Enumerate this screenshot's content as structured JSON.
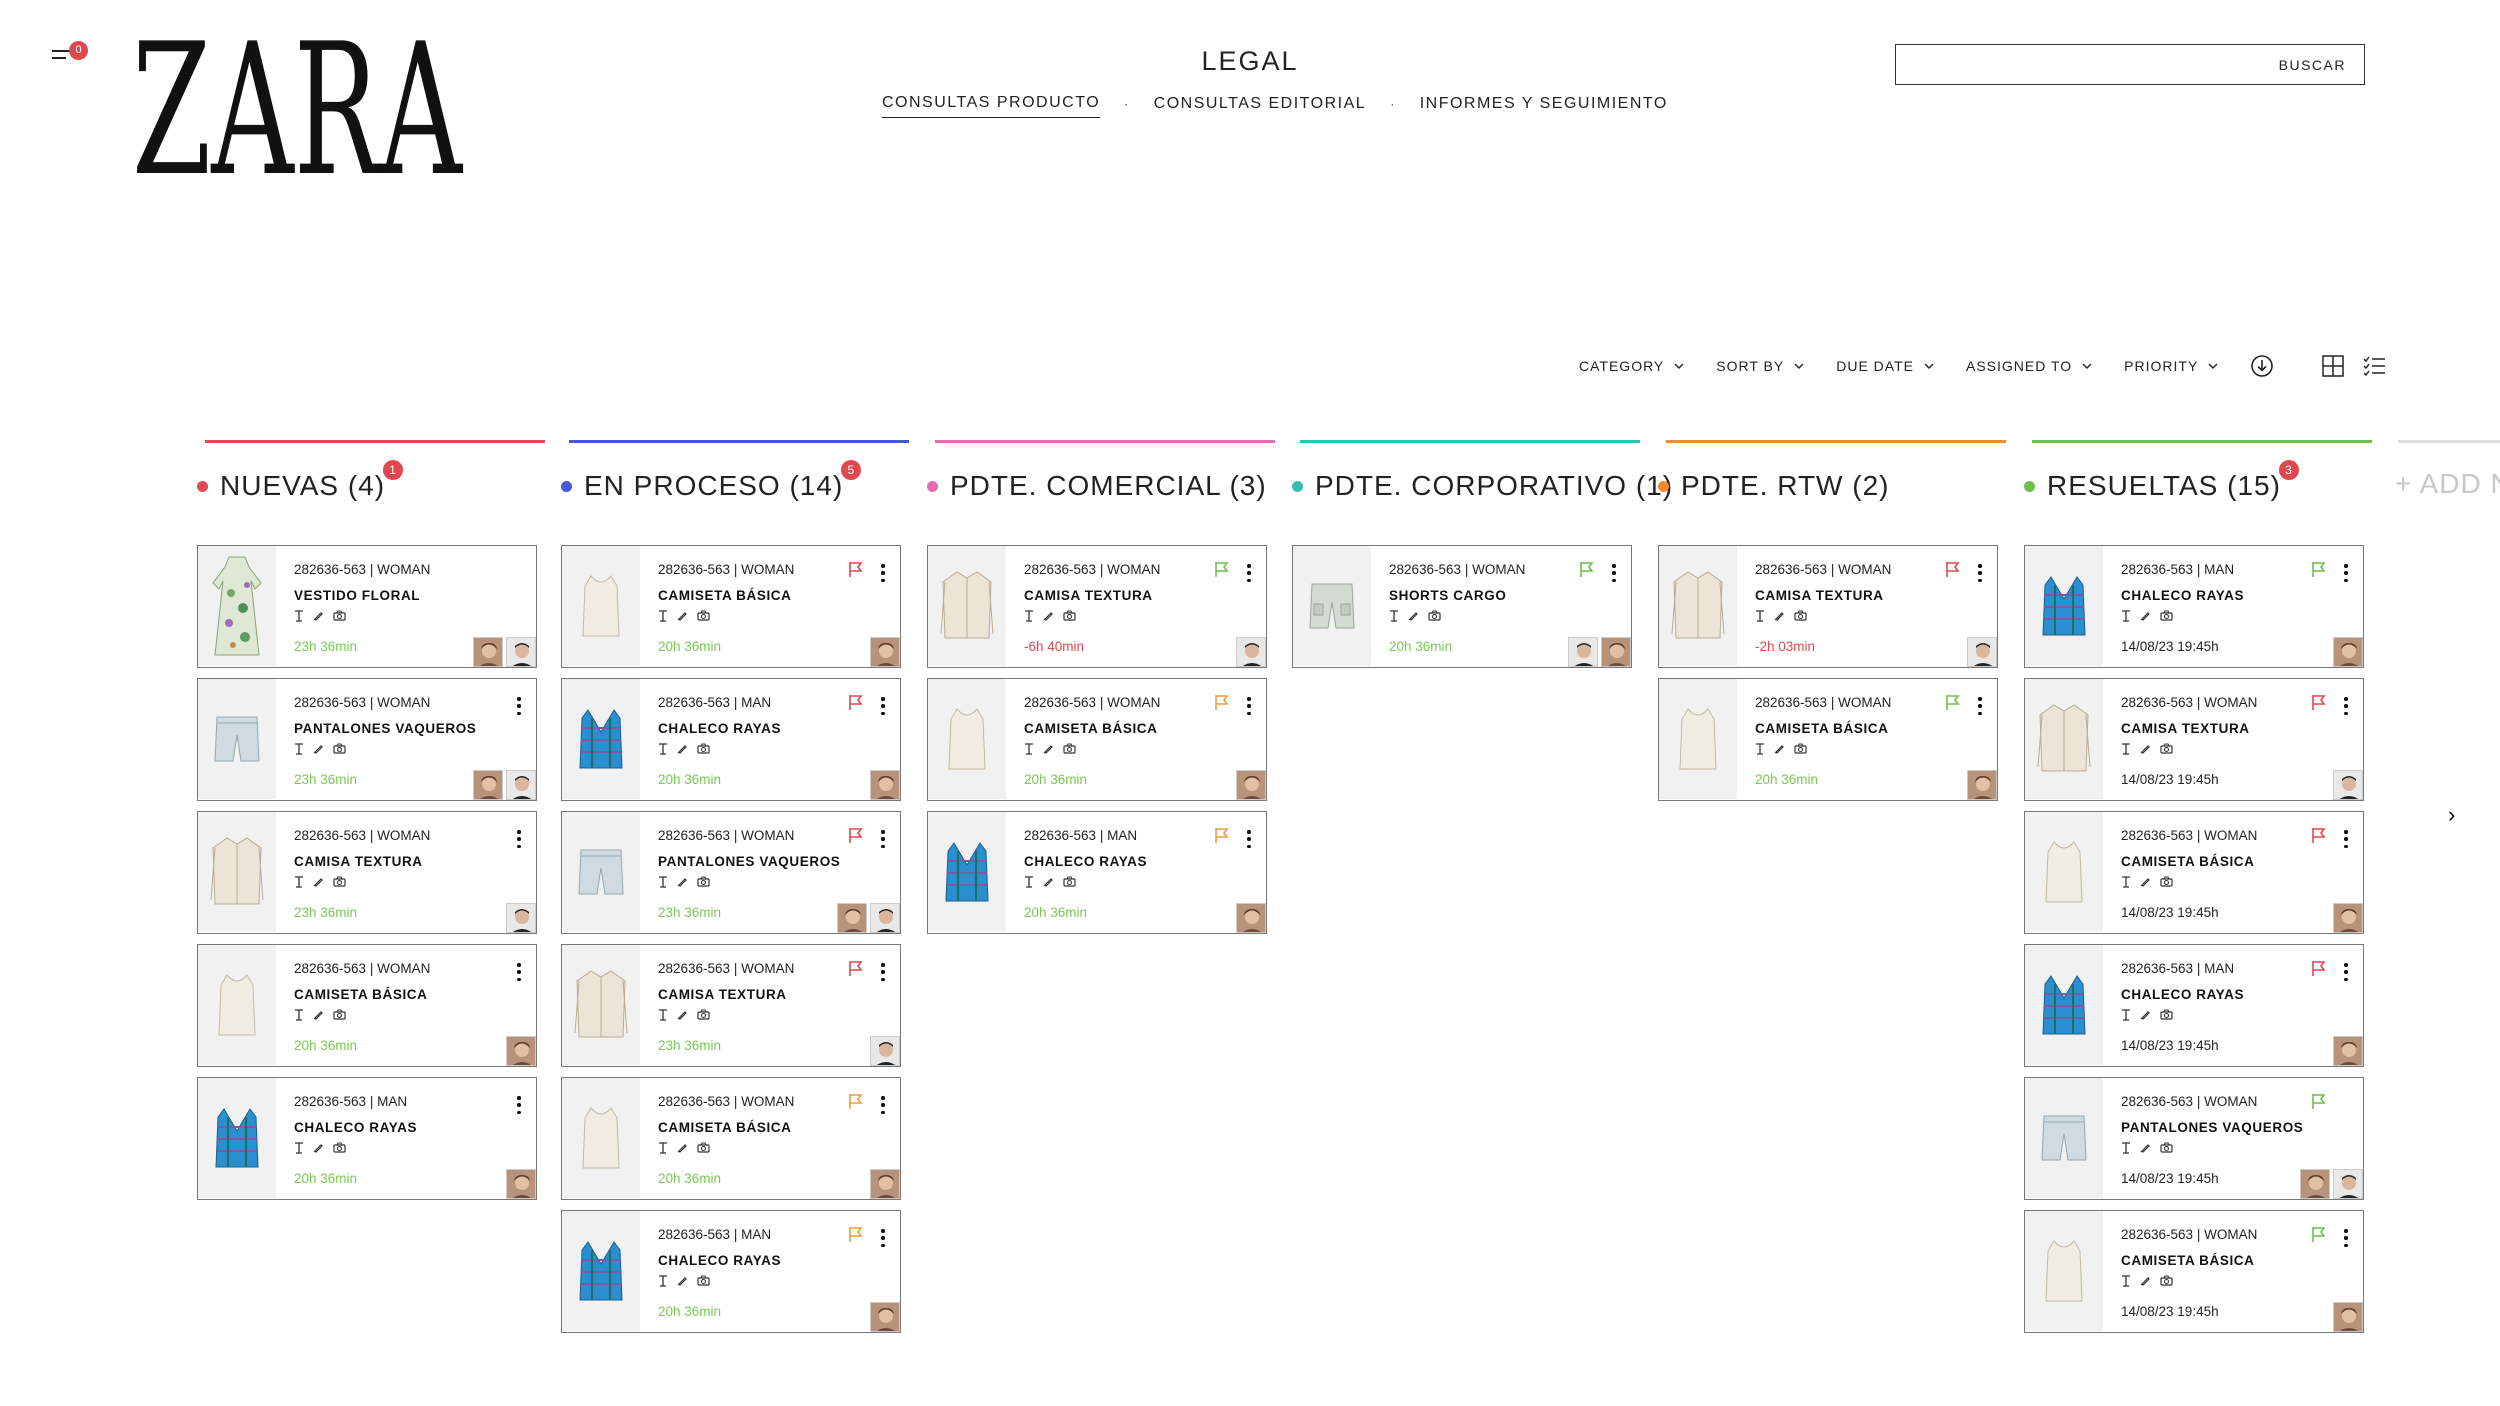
{
  "header": {
    "menu_badge": "0",
    "logo": "ZARA",
    "title": "LEGAL",
    "nav": [
      {
        "label": "CONSULTAS PRODUCTO",
        "active": true
      },
      {
        "label": "CONSULTAS EDITORIAL",
        "active": false
      },
      {
        "label": "INFORMES Y SEGUIMIENTO",
        "active": false
      }
    ],
    "nav_separator": "·",
    "search": {
      "placeholder": "",
      "button_label": "BUSCAR"
    }
  },
  "filters": [
    "CATEGORY",
    "SORT BY",
    "DUE DATE",
    "ASSIGNED TO",
    "PRIORITY"
  ],
  "view_icons": [
    "download-icon",
    "grid-view-icon",
    "list-view-icon"
  ],
  "add_column_label": "+ ADD N",
  "colors": {
    "time_green": "#79c853",
    "time_red": "#e0484f",
    "flag_red": "#e0484f",
    "flag_orange": "#f29d38",
    "flag_green": "#6cc24a",
    "badge": "#e0484f"
  },
  "columns": [
    {
      "title": "NUEVAS (4)",
      "badge": "1",
      "color": "#e04953",
      "cards": [
        {
          "code": "282636-563  | WOMAN",
          "name": "VESTIDO FLORAL",
          "time": "23h 36min",
          "time_color": "green",
          "flag": "",
          "menu": false,
          "product": "dress",
          "avatars": [
            "a",
            "b"
          ]
        },
        {
          "code": "282636-563  | WOMAN",
          "name": "PANTALONES VAQUEROS",
          "time": "23h 36min",
          "time_color": "green",
          "flag": "",
          "menu": true,
          "product": "shorts",
          "avatars": [
            "a",
            "b"
          ]
        },
        {
          "code": "282636-563  | WOMAN",
          "name": "CAMISA TEXTURA",
          "time": "23h 36min",
          "time_color": "green",
          "flag": "",
          "menu": true,
          "product": "shirt",
          "avatars": [
            "b"
          ]
        },
        {
          "code": "282636-563  | WOMAN",
          "name": "CAMISETA BÁSICA",
          "time": "20h 36min",
          "time_color": "green",
          "flag": "",
          "menu": true,
          "product": "tank",
          "avatars": [
            "a"
          ]
        },
        {
          "code": "282636-563  | MAN",
          "name": "CHALECO RAYAS",
          "time": "20h 36min",
          "time_color": "green",
          "flag": "",
          "menu": true,
          "product": "vest",
          "avatars": [
            "a"
          ]
        }
      ]
    },
    {
      "title": "EN PROCESO (14)",
      "badge": "5",
      "color": "#4559d6",
      "cards": [
        {
          "code": "282636-563  | WOMAN",
          "name": "CAMISETA BÁSICA",
          "time": "20h 36min",
          "time_color": "green",
          "flag": "red",
          "menu": true,
          "product": "tank",
          "avatars": [
            "a"
          ]
        },
        {
          "code": "282636-563  | MAN",
          "name": "CHALECO RAYAS",
          "time": "20h 36min",
          "time_color": "green",
          "flag": "red",
          "menu": true,
          "product": "vest",
          "avatars": [
            "a"
          ]
        },
        {
          "code": "282636-563  | WOMAN",
          "name": "PANTALONES VAQUEROS",
          "time": "23h 36min",
          "time_color": "green",
          "flag": "red",
          "menu": true,
          "product": "shorts",
          "avatars": [
            "a",
            "b"
          ]
        },
        {
          "code": "282636-563  | WOMAN",
          "name": "CAMISA TEXTURA",
          "time": "23h 36min",
          "time_color": "green",
          "flag": "red",
          "menu": true,
          "product": "shirt",
          "avatars": [
            "b"
          ]
        },
        {
          "code": "282636-563  | WOMAN",
          "name": "CAMISETA BÁSICA",
          "time": "20h 36min",
          "time_color": "green",
          "flag": "orange",
          "menu": true,
          "product": "tank",
          "avatars": [
            "a"
          ]
        },
        {
          "code": "282636-563  | MAN",
          "name": "CHALECO RAYAS",
          "time": "20h 36min",
          "time_color": "green",
          "flag": "orange",
          "menu": true,
          "product": "vest",
          "avatars": [
            "a"
          ]
        }
      ]
    },
    {
      "title": "PDTE. COMERCIAL (3)",
      "badge": "",
      "color": "#e86ab3",
      "cards": [
        {
          "code": "282636-563  | WOMAN",
          "name": "CAMISA TEXTURA",
          "time": "-6h 40min",
          "time_color": "red",
          "flag": "green",
          "menu": true,
          "product": "shirt",
          "avatars": [
            "b"
          ]
        },
        {
          "code": "282636-563  | WOMAN",
          "name": "CAMISETA BÁSICA",
          "time": "20h 36min",
          "time_color": "green",
          "flag": "orange",
          "menu": true,
          "product": "tank",
          "avatars": [
            "a"
          ]
        },
        {
          "code": "282636-563  | MAN",
          "name": "CHALECO RAYAS",
          "time": "20h 36min",
          "time_color": "green",
          "flag": "orange",
          "menu": true,
          "product": "vest",
          "avatars": [
            "a"
          ]
        }
      ]
    },
    {
      "title": "PDTE. CORPORATIVO (1)",
      "badge": "",
      "color": "#2cc1b3",
      "cards": [
        {
          "code": "282636-563  | WOMAN",
          "name": "SHORTS CARGO",
          "time": "20h 36min",
          "time_color": "green",
          "flag": "green",
          "menu": true,
          "product": "cargo",
          "avatars": [
            "b",
            "a"
          ]
        }
      ]
    },
    {
      "title": "PDTE. RTW (2)",
      "badge": "",
      "color": "#f28a2e",
      "cards": [
        {
          "code": "282636-563  | WOMAN",
          "name": "CAMISA TEXTURA",
          "time": "-2h 03min",
          "time_color": "red",
          "flag": "red",
          "menu": true,
          "product": "shirt",
          "avatars": [
            "b"
          ]
        },
        {
          "code": "282636-563  | WOMAN",
          "name": "CAMISETA BÁSICA",
          "time": "20h 36min",
          "time_color": "green",
          "flag": "green",
          "menu": true,
          "product": "tank",
          "avatars": [
            "a"
          ]
        }
      ]
    },
    {
      "title": "RESUELTAS (15)",
      "badge": "3",
      "color": "#6cc24a",
      "cards": [
        {
          "code": "282636-563  | MAN",
          "name": "CHALECO RAYAS",
          "time": "14/08/23 19:45h",
          "time_color": "dark",
          "flag": "green",
          "menu": true,
          "product": "vest",
          "avatars": [
            "a"
          ]
        },
        {
          "code": "282636-563  | WOMAN",
          "name": "CAMISA TEXTURA",
          "time": "14/08/23 19:45h",
          "time_color": "dark",
          "flag": "red",
          "menu": true,
          "product": "shirt",
          "avatars": [
            "b"
          ]
        },
        {
          "code": "282636-563  | WOMAN",
          "name": "CAMISETA BÁSICA",
          "time": "14/08/23 19:45h",
          "time_color": "dark",
          "flag": "red",
          "menu": true,
          "product": "tank",
          "avatars": [
            "a"
          ]
        },
        {
          "code": "282636-563  | MAN",
          "name": "CHALECO RAYAS",
          "time": "14/08/23 19:45h",
          "time_color": "dark",
          "flag": "red",
          "menu": true,
          "product": "vest",
          "avatars": [
            "a"
          ]
        },
        {
          "code": "282636-563  | WOMAN",
          "name": "PANTALONES VAQUEROS",
          "time": "14/08/23 19:45h",
          "time_color": "dark",
          "flag": "green",
          "menu": false,
          "product": "shorts",
          "avatars": [
            "a",
            "b"
          ]
        },
        {
          "code": "282636-563  | WOMAN",
          "name": "CAMISETA BÁSICA",
          "time": "14/08/23 19:45h",
          "time_color": "dark",
          "flag": "green",
          "menu": true,
          "product": "tank",
          "avatars": [
            "a"
          ]
        }
      ]
    }
  ]
}
